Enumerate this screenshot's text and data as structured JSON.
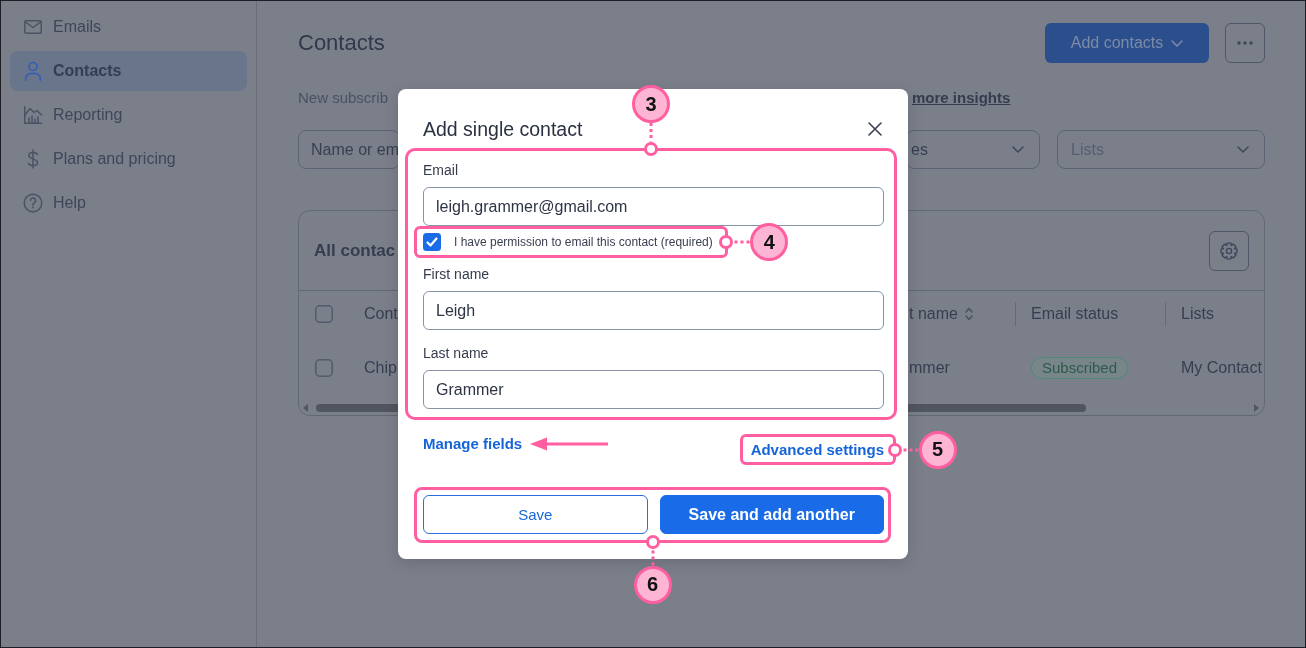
{
  "sidebar": {
    "items": [
      {
        "label": "Emails",
        "selected": false
      },
      {
        "label": "Contacts",
        "selected": true
      },
      {
        "label": "Reporting",
        "selected": false
      },
      {
        "label": "Plans and pricing",
        "selected": false
      },
      {
        "label": "Help",
        "selected": false
      }
    ]
  },
  "header": {
    "title": "Contacts",
    "add_button": "Add contacts"
  },
  "insights": {
    "text": "New subscrib",
    "link": "more insights"
  },
  "filters": {
    "search": {
      "placeholder": "Name or em"
    },
    "dropdowns": [
      {
        "value": "es"
      },
      {
        "placeholder": "Lists"
      }
    ]
  },
  "table": {
    "title": "All contac",
    "select_all": {
      "checked": false
    },
    "columns": [
      {
        "label": "Cont",
        "sortable": false
      },
      {
        "label": "t name",
        "sortable": true
      },
      {
        "label": "Email status",
        "sortable": false
      },
      {
        "label": "Lists",
        "sortable": false
      }
    ],
    "rows": [
      {
        "checked": false,
        "cells": [
          {
            "kind": "text",
            "text": "Chip"
          },
          {
            "kind": "text",
            "text": "mmer"
          },
          {
            "kind": "badge",
            "text": "Subscribed"
          },
          {
            "kind": "text",
            "text": "My Contact"
          }
        ]
      }
    ]
  },
  "modal": {
    "title": "Add single contact",
    "form": {
      "callout": "3",
      "fields": [
        {
          "kind": "input",
          "label": "Email",
          "value": "leigh.grammer@gmail.com"
        },
        {
          "kind": "checkbox",
          "label": "I have permission to email this contact (required)",
          "checked": true,
          "callout": "4"
        },
        {
          "kind": "input",
          "label": "First name",
          "value": "Leigh"
        },
        {
          "kind": "input",
          "label": "Last name",
          "value": "Grammer"
        }
      ]
    },
    "manage_link": {
      "label": "Manage fields",
      "arrow": true
    },
    "advanced_link": {
      "label": "Advanced settings",
      "callout": "5"
    },
    "buttons": {
      "callout": "6",
      "items": [
        {
          "kind": "secondary",
          "label": "Save"
        },
        {
          "kind": "primary",
          "label": "Save and add another"
        }
      ]
    }
  }
}
